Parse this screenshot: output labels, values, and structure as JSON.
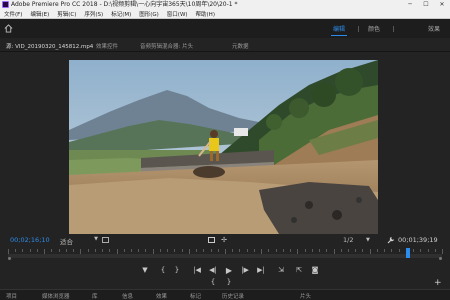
{
  "window": {
    "title": "Adobe Premiere Pro CC 2018 - D:\\视频剪辑\\一心向宇宙365天\\10周年\\20\\20-1 *",
    "minimize_glyph": "─",
    "maximize_glyph": "☐",
    "close_glyph": "✕"
  },
  "menu": {
    "items": [
      "文件(F)",
      "编辑(E)",
      "剪辑(C)",
      "序列(S)",
      "标记(M)",
      "图形(G)",
      "窗口(W)",
      "帮助(H)"
    ]
  },
  "workspace": {
    "tabs": [
      {
        "label": "编辑",
        "active": true
      },
      {
        "label": "颜色",
        "active": false
      },
      {
        "label": "效果",
        "active": false
      }
    ]
  },
  "panels": {
    "source_tab": "源: VID_20190320_145812.mp4",
    "tabs": [
      "效果控件",
      "音频剪辑混合器: 片头",
      "元数据"
    ]
  },
  "monitor": {
    "timecode_current": "00;02;16;10",
    "fit_label": "适合",
    "quality_label": "1/2",
    "timecode_duration": "00;01;39;19",
    "playhead_fraction": 0.917
  },
  "transport": {
    "marker_glyph": "▼",
    "in_glyph": "{",
    "out_glyph": "}",
    "goto_in_glyph": "|◀",
    "step_back_glyph": "◀|",
    "play_glyph": "▶",
    "step_forward_glyph": "|▶",
    "goto_out_glyph": "▶|",
    "insert_glyph": "⇲",
    "overwrite_glyph": "⇱",
    "export_frame_glyph": "◙",
    "add_glyph": "+",
    "sub_in_glyph": "{",
    "sub_out_glyph": "}"
  },
  "bottom_panels": {
    "tabs": [
      "项目",
      "媒体浏览器",
      "库",
      "信息",
      "效果",
      "标记",
      "历史记录",
      "片头"
    ]
  },
  "colors": {
    "accent": "#2d8ceb",
    "panel_bg": "#232323",
    "title_bg": "#f0f0f0"
  }
}
